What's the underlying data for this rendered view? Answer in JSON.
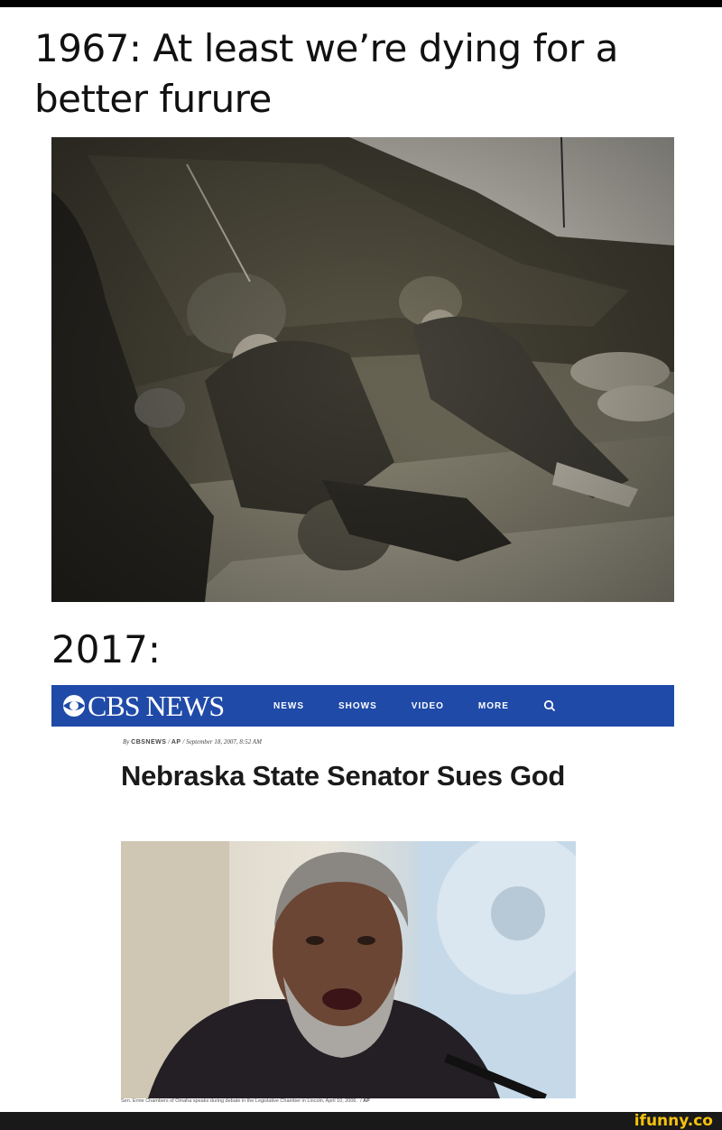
{
  "caption_top": "1967: At least we’re dying for a better furure",
  "caption_mid": "2017:",
  "cbs": {
    "logo_text": "CBS NEWS",
    "nav": [
      "NEWS",
      "SHOWS",
      "VIDEO",
      "MORE"
    ],
    "search_icon": "search-icon",
    "brand_color": "#1f4aa8"
  },
  "article": {
    "byline_by": "By",
    "byline_source": "CBSNEWS",
    "byline_ap": "AP",
    "byline_date": "September 18, 2007, 8:52 AM",
    "headline": "Nebraska State Senator Sues God",
    "photo_caption": "Sen. Ernie Chambers of Omaha speaks during debate in the Legislative Chamber in Lincoln, April 10, 2006.",
    "photo_credit": "AP"
  },
  "watermark": "ifunny.co",
  "watermark_color": "#f4c20d"
}
